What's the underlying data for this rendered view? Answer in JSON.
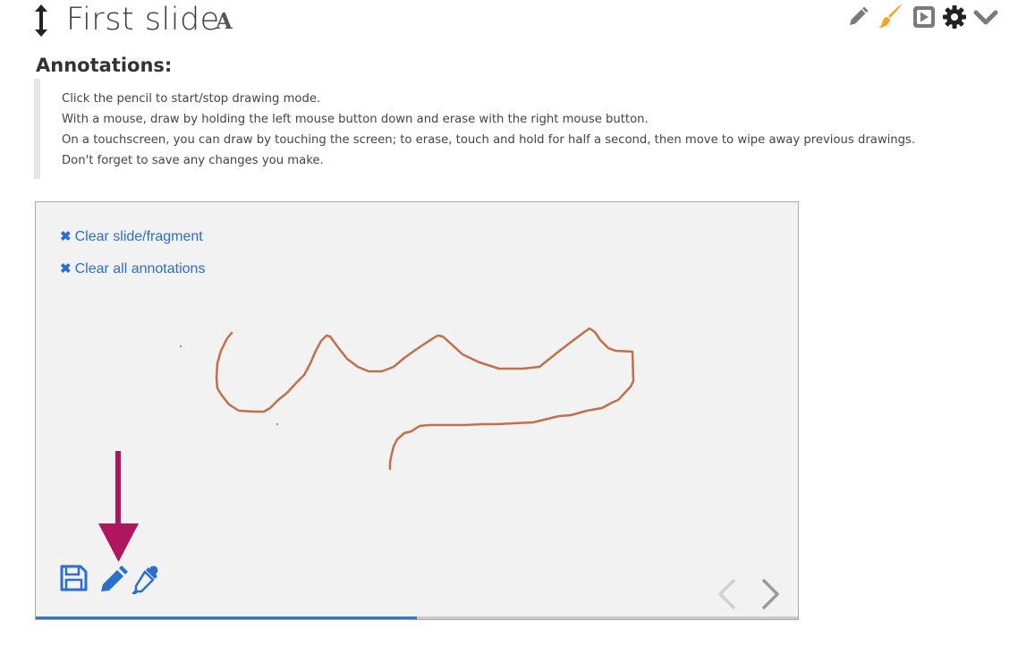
{
  "header": {
    "title": "First slide",
    "title_badge": "A",
    "toolbar_icons": [
      "pencil-icon",
      "paintbrush-icon",
      "play-icon",
      "gear-icon",
      "chevron-down-icon"
    ],
    "accent_brush": "#f7a21b",
    "icon_gray": "#7a7a7a"
  },
  "annotations": {
    "heading": "Annotations:",
    "lines": [
      "Click the pencil to start/stop drawing mode.",
      "With a mouse, draw by holding the left mouse button down and erase with the right mouse button.",
      "On a touchscreen, you can draw by touching the screen; to erase, touch and hold for half a second, then move to wipe away previous drawings.",
      "Don't forget to save any changes you make."
    ]
  },
  "slide": {
    "clear_slide_label": "Clear slide/fragment",
    "clear_all_label": "Clear all annotations",
    "link_color": "#2a6fce",
    "drawing_color": "#c2704a",
    "pointer_arrow_color": "#b0155f",
    "bottom_icons": [
      "save-icon",
      "pencil-icon",
      "eyedropper-icon"
    ],
    "nav_icons": [
      "nav-prev-icon",
      "nav-next-icon"
    ],
    "progress": 0.5
  }
}
